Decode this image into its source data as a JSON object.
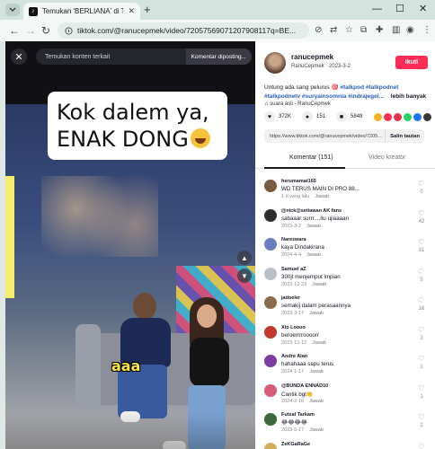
{
  "browser": {
    "tab_title": "Temukan 'BERLIANA' di Tik...",
    "tab_close": "✕",
    "new_tab": "+",
    "url": "tiktok.com/@ranucepmek/video/72057569071207908117q=BE...",
    "window_controls": [
      "—",
      "☐",
      "✕"
    ]
  },
  "video": {
    "search_placeholder": "Temukan konten terkait",
    "report_label": "Komentar diposting...",
    "caption_line1": "Kok dalem ya,",
    "caption_line2": "ENAK DONG",
    "subtitle": "aaa",
    "close_icon": "close-icon"
  },
  "author": {
    "username": "ranucepmek",
    "subline": "RanuCepmek · 2023-3-2",
    "follow_label": "Ikuti"
  },
  "description": {
    "text": "Untung ada sang pelurus",
    "hashtags": [
      "#talkpod",
      "#talkpodnet",
      "#talkpodnetv",
      "#suryainsomnia",
      "#indrajegel..."
    ],
    "more_label": "lebih banyak",
    "sound": "suara asli - RanuCepmek"
  },
  "stats": {
    "likes": "372K",
    "comments": "151",
    "saves": "5849"
  },
  "share": {
    "link": "https://www.tiktok.com/@ranucepmek/video/7205...",
    "copy_label": "Salin tautan",
    "colors": [
      "#f5b325",
      "#fe2c55",
      "#e6334a",
      "#25d366",
      "#1877f2",
      "#3a3a3a"
    ]
  },
  "tabs": {
    "comments_label": "Komentar (151)",
    "creator_label": "Video kreator"
  },
  "comments": [
    {
      "user": "herumamat165",
      "text": "WD TERUS MAIN DI PRO 88...",
      "date": "1 d yang lalu",
      "reply": "Jawab",
      "likes": "0",
      "avatar_color": "#7a5a40"
    },
    {
      "user": "@nick@setiawan AK fans",
      "text": "sabaaar surrr....itu ujiaaaan",
      "date": "2023-3-2",
      "reply": "Jawab",
      "likes": "42",
      "avatar_color": "#2d2d2d"
    },
    {
      "user": "Narezwara",
      "text": "kaya Dindakirana",
      "date": "2024-4-4",
      "reply": "Jawab",
      "likes": "31",
      "avatar_color": "#6a7dbf"
    },
    {
      "user": "Samuel aZ",
      "text": "300jt menjemput impian",
      "date": "2023-12-23",
      "reply": "Jawab",
      "likes": "5",
      "avatar_color": "#b8c0c8"
    },
    {
      "user": "jadoeler",
      "text": "semakij dalam perasaannya",
      "date": "2023-3-17",
      "reply": "Jawab",
      "likes": "16",
      "avatar_color": "#8a6b4a"
    },
    {
      "user": "Xio Loooo",
      "text": "beroerrrroooorr",
      "date": "2023-12-12",
      "reply": "Jawab",
      "likes": "2",
      "avatar_color": "#c0392b"
    },
    {
      "user": "Andre Alan",
      "text": "hahahaaa sapu terus",
      "date": "2024-1-17",
      "reply": "Jawab",
      "likes": "1",
      "avatar_color": "#7a3fa0"
    },
    {
      "user": "@BUNDA ENNAD10",
      "text": "Cantik bgt👏",
      "date": "2024-2-16",
      "reply": "Jawab",
      "likes": "1",
      "avatar_color": "#d65a7a"
    },
    {
      "user": "Futsal Tarkam",
      "text": "😂😂😂😂",
      "date": "2023-5-17",
      "reply": "Jawab",
      "likes": "2",
      "avatar_color": "#3a6a3a"
    },
    {
      "user": "ZeKGaRaGe",
      "text": "😂",
      "date": "4 h yang lalu",
      "reply": "Jawab",
      "likes": "0",
      "avatar_color": "#d0b060"
    }
  ]
}
